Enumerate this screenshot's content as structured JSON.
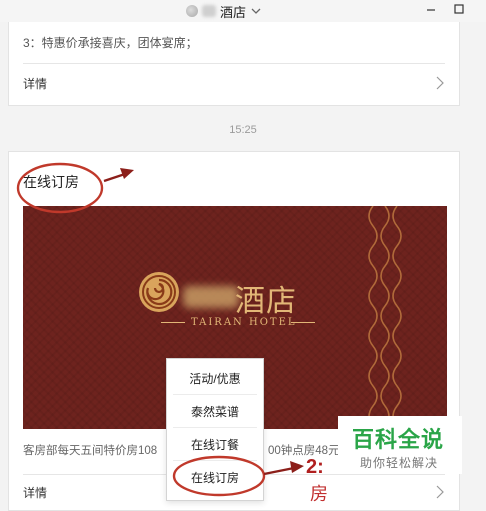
{
  "window": {
    "title": "酒店",
    "colors": {
      "accent_red": "#8c1f1a",
      "banner_bg": "#6e231e",
      "banner_gold": "#e2b777",
      "watermark_green": "#2aa548"
    }
  },
  "top_card": {
    "line": "3：特惠价承接喜庆，团体宴席；",
    "detail_label": "详情"
  },
  "timestamp": "15:25",
  "main_card": {
    "title": "在线订房",
    "banner": {
      "name": "酒店",
      "subtitle": "TAIRAN HOTEL"
    },
    "description_left": "客房部每天五间特价房108",
    "description_right": "00钟点房48元/",
    "detail_label": "详情"
  },
  "popup_menu": {
    "items": [
      {
        "label": "活动/优惠"
      },
      {
        "label": "泰然菜谱"
      },
      {
        "label": "在线订餐"
      },
      {
        "label": "在线订房"
      }
    ]
  },
  "annotation": {
    "number": "2:",
    "label": "房"
  },
  "watermark": {
    "title": "百科全说",
    "subtitle": "助你轻松解决"
  }
}
